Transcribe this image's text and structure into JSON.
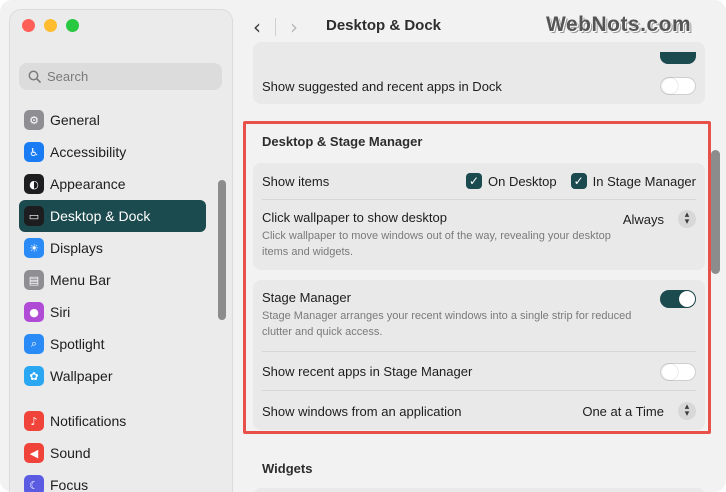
{
  "window": {
    "title": "Desktop & Dock",
    "watermark": "WebNots.com"
  },
  "search": {
    "placeholder": "Search"
  },
  "sidebar": {
    "items": [
      {
        "label": "General",
        "icon": "gear-icon",
        "color": "#8e8e93",
        "glyph": "⚙"
      },
      {
        "label": "Accessibility",
        "icon": "accessibility-icon",
        "color": "#1a7cf5",
        "glyph": "♿"
      },
      {
        "label": "Appearance",
        "icon": "appearance-icon",
        "color": "#1d1d1f",
        "glyph": "◐"
      },
      {
        "label": "Desktop & Dock",
        "icon": "dock-icon",
        "color": "#1d1d1f",
        "glyph": "▭",
        "selected": true
      },
      {
        "label": "Displays",
        "icon": "displays-icon",
        "color": "#2a8af6",
        "glyph": "☀"
      },
      {
        "label": "Menu Bar",
        "icon": "menu-bar-icon",
        "color": "#8e8e93",
        "glyph": "▤"
      },
      {
        "label": "Siri",
        "icon": "siri-icon",
        "color": "#b04bd6",
        "glyph": "●"
      },
      {
        "label": "Spotlight",
        "icon": "spotlight-icon",
        "color": "#2a8af6",
        "glyph": "⌕"
      },
      {
        "label": "Wallpaper",
        "icon": "wallpaper-icon",
        "color": "#2aa7f2",
        "glyph": "✿"
      }
    ],
    "items2": [
      {
        "label": "Notifications",
        "icon": "notifications-icon",
        "color": "#f0443a",
        "glyph": "♪"
      },
      {
        "label": "Sound",
        "icon": "sound-icon",
        "color": "#f0443a",
        "glyph": "◀"
      },
      {
        "label": "Focus",
        "icon": "focus-icon",
        "color": "#5b5ce2",
        "glyph": "☾"
      }
    ]
  },
  "content": {
    "dock_row": {
      "label": "Show suggested and recent apps in Dock",
      "enabled": false
    },
    "section_title": "Desktop & Stage Manager",
    "show_items": {
      "label": "Show items",
      "on_desktop": "On Desktop",
      "in_stage_manager": "In Stage Manager"
    },
    "click_wallpaper": {
      "label": "Click wallpaper to show desktop",
      "value": "Always",
      "description": "Click wallpaper to move windows out of the way, revealing your desktop items and widgets."
    },
    "stage_manager": {
      "label": "Stage Manager",
      "enabled": true,
      "description": "Stage Manager arranges your recent windows into a single strip for reduced clutter and quick access."
    },
    "recent_apps": {
      "label": "Show recent apps in Stage Manager",
      "enabled": false
    },
    "show_windows": {
      "label": "Show windows from an application",
      "value": "One at a Time"
    },
    "widgets_title": "Widgets"
  },
  "colors": {
    "accent": "#1b4a4f",
    "highlight_border": "#e8504a"
  }
}
